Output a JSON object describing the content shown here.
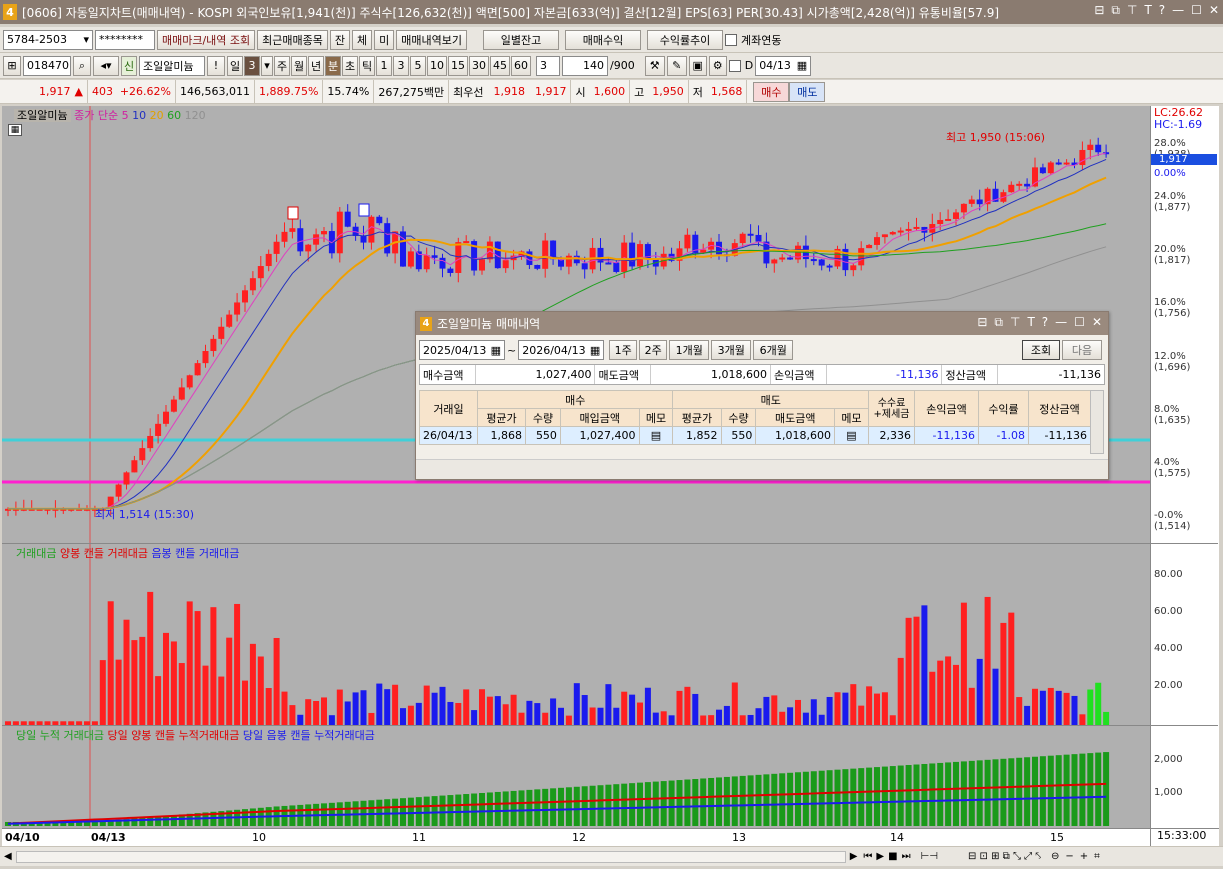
{
  "window": {
    "title": "[0606] 자동일지차트(매매내역) - KOSPI 외국인보유[1,941(천)] 주식수[126,632(천)] 액면[500] 자본금[633(억)] 결산[12월] EPS[63] PER[30.43] 시가총액[2,428(억)] 유통비율[57.9]",
    "app_badge": "4"
  },
  "toolbar1": {
    "account": "5784-2503",
    "password": "********",
    "btn_mark": "매매마크/내역 조회",
    "btn_recent": "최근매매종목",
    "btn_jan": "잔",
    "btn_che": "체",
    "btn_mi": "미",
    "btn_history": "매매내역보기",
    "btn_daily": "일별잔고",
    "btn_profit": "매매수익",
    "btn_rate": "수익률추이",
    "chk_link": "계좌연동"
  },
  "toolbar2": {
    "code": "018470",
    "shin": "신",
    "stock_name": "조일알미늄",
    "excl": "!",
    "periods": [
      "일",
      "3",
      "주",
      "월",
      "년",
      "분",
      "초",
      "틱",
      "1",
      "3",
      "5",
      "10",
      "15",
      "30",
      "45",
      "60"
    ],
    "sel_period": "분",
    "sel_interval": "3",
    "interval_value": "3",
    "count": "140",
    "count_total": "/900",
    "date_chk": "D",
    "date": "04/13"
  },
  "quote": {
    "price": "1,917",
    "change": "403",
    "change_pct": "+26.62%",
    "volume": "146,563,011",
    "vol_ratio": "1,889.75%",
    "turnover": "15.74%",
    "amount": "267,275백만",
    "best_label": "최우선",
    "ask": "1,918",
    "bid": "1,917",
    "open_label": "시",
    "open": "1,600",
    "high_label": "고",
    "high": "1,950",
    "low_label": "저",
    "low": "1,568",
    "buy": "매수",
    "sell": "매도"
  },
  "price_pane": {
    "stock_tag": "조일알미늄",
    "ma_label": "종가 단순",
    "ma": [
      "5",
      "10",
      "20",
      "60",
      "120"
    ],
    "high_note": "최고 1,950 (15:06)",
    "low_note": "최저 1,514 (15:30)",
    "lc": "LC:26.62",
    "hc": "HC:-1.69",
    "current_tag": "1,917",
    "axis": [
      {
        "pct": "28.0%",
        "val": "(1,938)"
      },
      {
        "pct": "0.00%",
        "val": ""
      },
      {
        "pct": "24.0%",
        "val": "(1,877)"
      },
      {
        "pct": "20.0%",
        "val": "(1,817)"
      },
      {
        "pct": "16.0%",
        "val": "(1,756)"
      },
      {
        "pct": "12.0%",
        "val": "(1,696)"
      },
      {
        "pct": "8.0%",
        "val": "(1,635)"
      },
      {
        "pct": "4.0%",
        "val": "(1,575)"
      },
      {
        "pct": "-0.0%",
        "val": "(1,514)"
      }
    ]
  },
  "volume_pane": {
    "legend": [
      "거래대금",
      "양봉 캔들 거래대금",
      "음봉 캔들 거래대금"
    ],
    "axis": [
      "80.00",
      "60.00",
      "40.00",
      "20.00"
    ]
  },
  "cum_pane": {
    "legend": [
      "당일 누적 거래대금",
      "당일 양봉 캔들 누적거래대금",
      "당일 음봉 캔들 누적거래대금"
    ],
    "axis": [
      "2,000",
      "1,000"
    ]
  },
  "time_axis": {
    "labels": [
      "04/10",
      "04/13",
      "10",
      "11",
      "12",
      "13",
      "14",
      "15"
    ],
    "clock": "15:33:00"
  },
  "dialog": {
    "badge": "4",
    "title": "조일알미늄 매매내역",
    "from": "2025/04/13",
    "tilde": "~",
    "to": "2026/04/13",
    "range_btns": [
      "1주",
      "2주",
      "1개월",
      "3개월",
      "6개월"
    ],
    "query": "조회",
    "next": "다음",
    "summary": {
      "buy_label": "매수금액",
      "buy": "1,027,400",
      "sell_label": "매도금액",
      "sell": "1,018,600",
      "pl_label": "손익금액",
      "pl": "-11,136",
      "settle_label": "정산금액",
      "settle": "-11,136"
    },
    "headers": {
      "date": "거래일",
      "buy": "매수",
      "sell": "매도",
      "fee": "수수료 +제세금",
      "pl": "손익금액",
      "rate": "수익률",
      "settle": "정산금액",
      "avg": "평균가",
      "qty": "수량",
      "buy_amt": "매입금액",
      "memo": "메모",
      "sell_amt": "매도금액"
    },
    "row": {
      "date": "26/04/13",
      "buy_avg": "1,868",
      "buy_qty": "550",
      "buy_amt": "1,027,400",
      "sell_avg": "1,852",
      "sell_qty": "550",
      "sell_amt": "1,018,600",
      "fee": "2,336",
      "pl": "-11,136",
      "rate": "-1.08",
      "settle": "-11,136"
    }
  },
  "colors": {
    "up": "#ff2020",
    "down": "#1a1aee",
    "ma5": "#e040c0",
    "ma10": "#2030c0",
    "ma20": "#f0a000",
    "ma60": "#20a020",
    "ma120": "#909090"
  }
}
